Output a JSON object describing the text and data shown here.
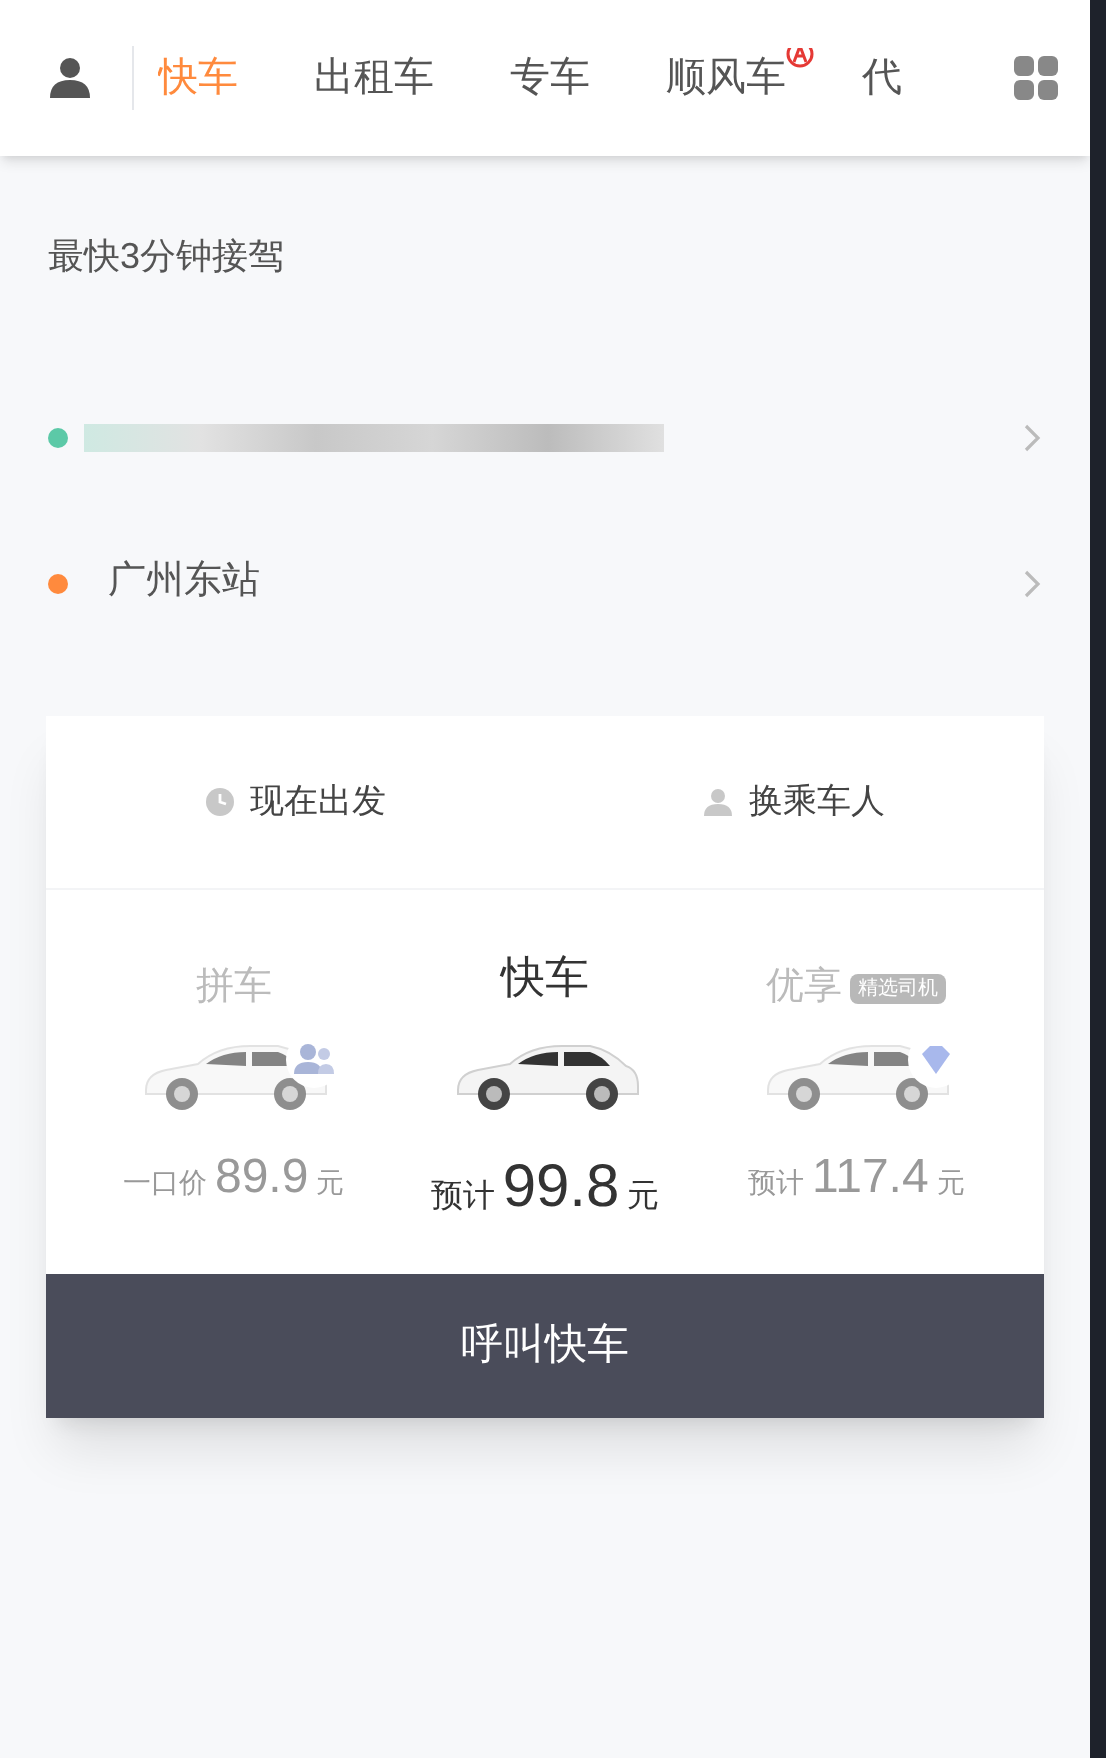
{
  "tabs": [
    {
      "label": "快车",
      "selected": true,
      "badge": false
    },
    {
      "label": "出租车",
      "selected": false,
      "badge": false
    },
    {
      "label": "专车",
      "selected": false,
      "badge": false
    },
    {
      "label": "顺风车",
      "selected": false,
      "badge": true
    },
    {
      "label": "代",
      "selected": false,
      "badge": false
    }
  ],
  "eta": "最快3分钟接驾",
  "addresses": [
    {
      "kind": "redacted",
      "color": "#5cc9a7"
    },
    {
      "kind": "text",
      "label": "广州东站",
      "color": "#ff8a3d"
    }
  ],
  "options": [
    {
      "label": "现在出发",
      "kind": "clock"
    },
    {
      "label": "换乘车人",
      "kind": "person"
    }
  ],
  "rides": [
    {
      "name": "拼车",
      "kind": "shared",
      "selected": false,
      "prefix": "一口价",
      "price": "89.9",
      "unit": "元"
    },
    {
      "name": "快车",
      "kind": "express",
      "selected": true,
      "prefix": "预计",
      "price": "99.8",
      "unit": "元"
    },
    {
      "name": "优享",
      "kind": "premium",
      "selected": false,
      "tag": "精选司机",
      "prefix": "预计",
      "price": "117.4",
      "unit": "元"
    }
  ],
  "call_button": "呼叫快车"
}
